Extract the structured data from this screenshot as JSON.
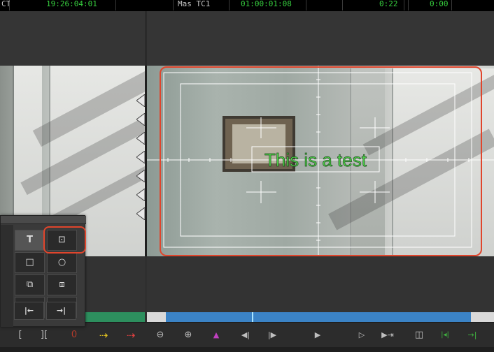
{
  "readouts": {
    "left_label": "CT",
    "left_tc": "19:26:04:01",
    "mid_label": "Mas TC1",
    "mid_tc": "01:00:01:08",
    "right_val_1": "0:22",
    "right_val_2": "0:00"
  },
  "title_text": "This is a test",
  "palette": {
    "tools": [
      {
        "name": "text-tool",
        "glyph": "T"
      },
      {
        "name": "safe-title-tool",
        "glyph": "⊡"
      },
      {
        "name": "rectangle-tool",
        "glyph": "□"
      },
      {
        "name": "oval-tool",
        "glyph": "○"
      },
      {
        "name": "bring-forward-tool",
        "glyph": "⧉"
      },
      {
        "name": "send-backward-tool",
        "glyph": "⧈"
      },
      {
        "name": "group-tool",
        "glyph": "⊞"
      },
      {
        "name": "ungroup-tool",
        "glyph": "⧠"
      },
      {
        "name": "align-left-tool",
        "glyph": "|←"
      },
      {
        "name": "align-right-tool",
        "glyph": "→|"
      }
    ]
  },
  "transport": [
    {
      "name": "mark-in-button",
      "glyph": "["
    },
    {
      "name": "mark-clip-button",
      "glyph": "][",
      "color": "#bfbfbf"
    },
    {
      "name": "record-indicator",
      "glyph": "0",
      "color": "#b23a2a"
    },
    {
      "name": "splice-in-button",
      "glyph": "⇢",
      "color": "#e0c020"
    },
    {
      "name": "overwrite-button",
      "glyph": "⇢",
      "color": "#e04040"
    },
    {
      "name": "zoom-out-button",
      "glyph": "⊖"
    },
    {
      "name": "zoom-in-button",
      "glyph": "⊕"
    },
    {
      "name": "marker-button",
      "glyph": "▲",
      "color": "#c040c0"
    },
    {
      "name": "step-back-button",
      "glyph": "◀|"
    },
    {
      "name": "step-forward-button",
      "glyph": "|▶"
    },
    {
      "name": "play-button",
      "glyph": "▶"
    },
    {
      "name": "play-in-out-button",
      "glyph": "▷"
    },
    {
      "name": "play-to-out-button",
      "glyph": "▶⇥"
    },
    {
      "name": "split-view-button",
      "glyph": "◫"
    },
    {
      "name": "go-to-in-button",
      "glyph": "|◂|",
      "color": "#3fb13f"
    },
    {
      "name": "go-to-out-button",
      "glyph": "→|",
      "color": "#3fb13f"
    }
  ]
}
